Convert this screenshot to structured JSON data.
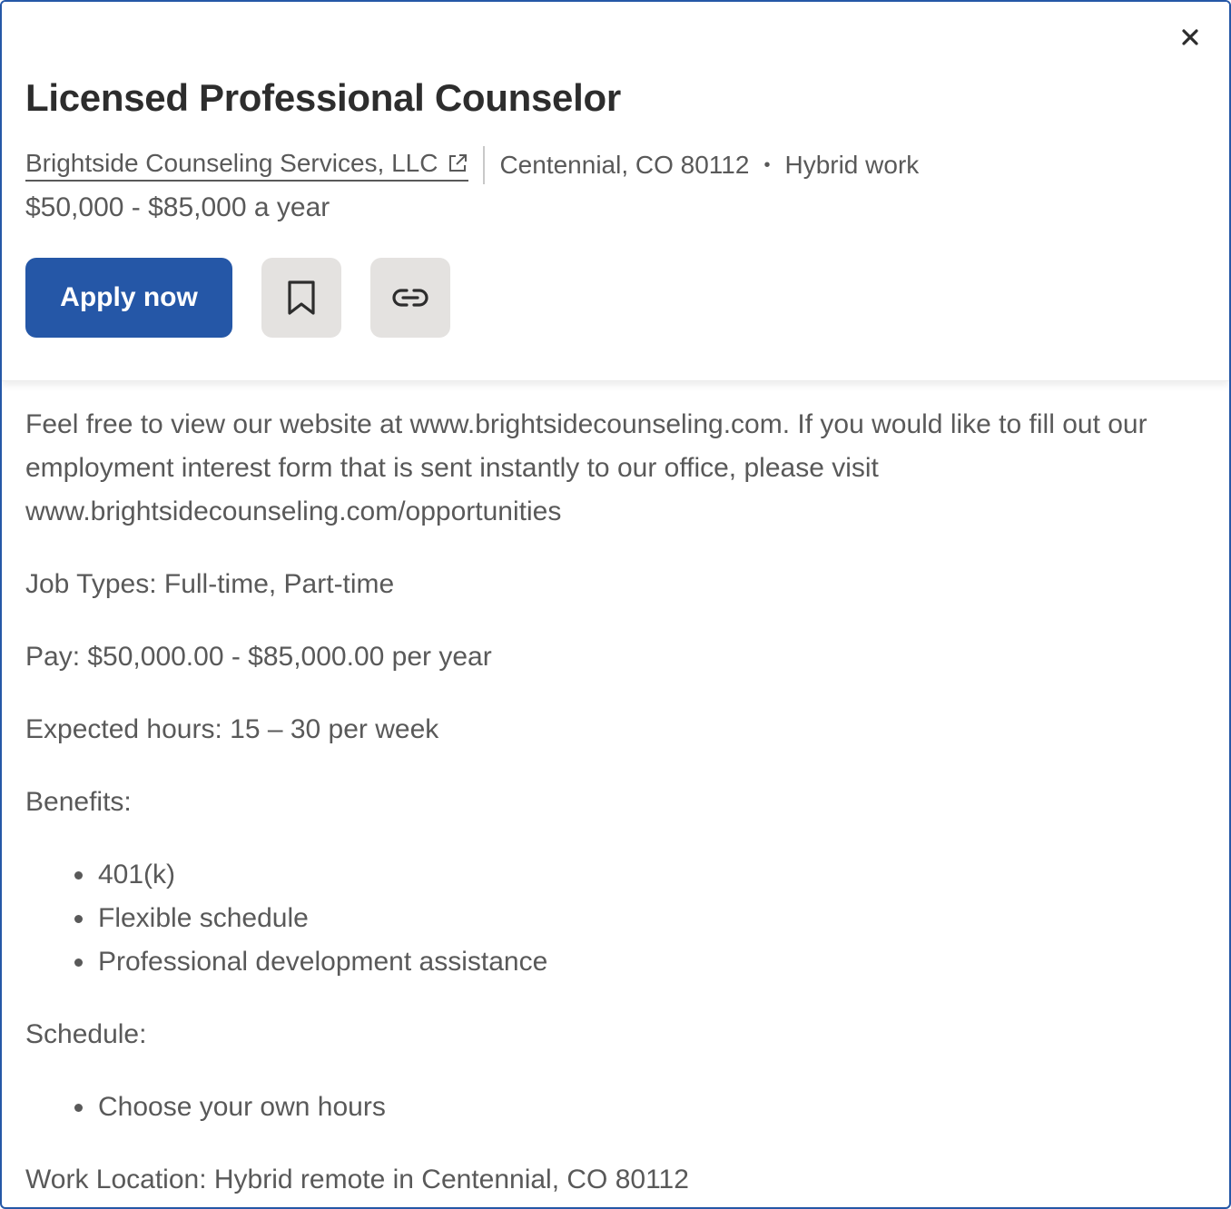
{
  "job": {
    "title": "Licensed Professional Counselor",
    "company": "Brightside Counseling Services, LLC",
    "location": "Centennial, CO 80112",
    "separator": "•",
    "work_type": "Hybrid work",
    "salary": "$50,000 - $85,000 a year"
  },
  "actions": {
    "apply_label": "Apply now",
    "save_icon": "bookmark-icon",
    "share_icon": "link-icon",
    "close_icon": "close-icon"
  },
  "description": {
    "intro": "Feel free to view our website at www.brightsidecounseling.com. If you would like to fill out our employment interest form that is sent instantly to our office, please visit www.brightsidecounseling.com/opportunities",
    "job_types": "Job Types: Full-time, Part-time",
    "pay": "Pay: $50,000.00 - $85,000.00 per year",
    "hours": "Expected hours: 15 – 30 per week",
    "benefits_heading": "Benefits:",
    "benefits": [
      "401(k)",
      "Flexible schedule",
      "Professional development assistance"
    ],
    "schedule_heading": "Schedule:",
    "schedule": [
      "Choose your own hours"
    ],
    "work_location": "Work Location: Hybrid remote in Centennial, CO 80112"
  },
  "colors": {
    "accent": "#2557a7",
    "text_primary": "#2d2d2d",
    "text_secondary": "#595959",
    "icon_button_bg": "#e4e2e0"
  }
}
